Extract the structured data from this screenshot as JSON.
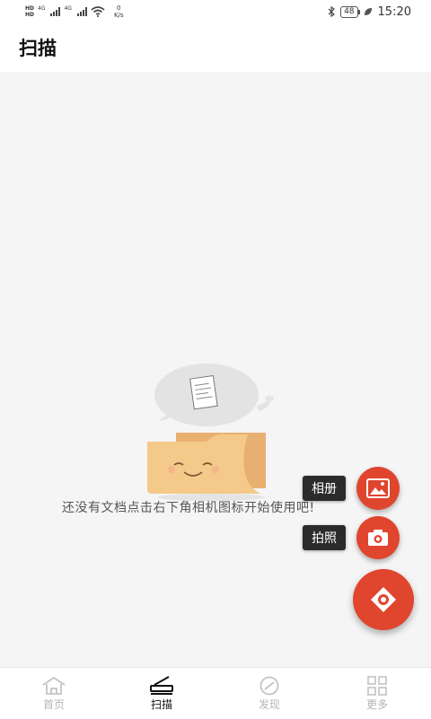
{
  "status_bar": {
    "hd1": "HD",
    "hd2": "HD",
    "net1": "4G",
    "net2": "4G",
    "speed_value": "0",
    "speed_unit": "K/s",
    "battery": "48",
    "time": "15:20"
  },
  "header": {
    "title": "扫描"
  },
  "empty_state": {
    "message": "还没有文档点击右下角相机图标开始使用吧!"
  },
  "fab": {
    "album_label": "相册",
    "photo_label": "拍照"
  },
  "bottom_nav": {
    "items": [
      {
        "label": "首页",
        "icon": "home-icon",
        "active": false
      },
      {
        "label": "扫描",
        "icon": "scanner-icon",
        "active": true
      },
      {
        "label": "发现",
        "icon": "compass-icon",
        "active": false
      },
      {
        "label": "更多",
        "icon": "grid-icon",
        "active": false
      }
    ]
  },
  "colors": {
    "accent": "#e0452e",
    "background": "#f5f5f5",
    "folder": "#f4c98a"
  }
}
